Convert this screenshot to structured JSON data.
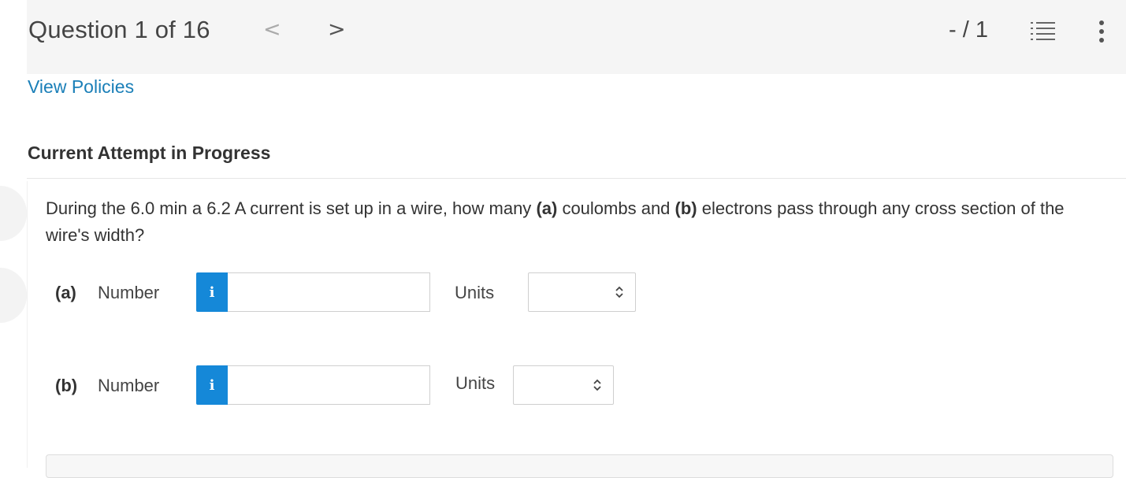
{
  "header": {
    "question_title": "Question 1 of 16",
    "prev_label": "<",
    "next_label": ">",
    "score": "- / 1"
  },
  "links": {
    "view_policies": "View Policies"
  },
  "attempt": {
    "status": "Current Attempt in Progress"
  },
  "question": {
    "text_1": "During the 6.0 min a 6.2 A current is set up in a wire, how many ",
    "part_a_bold": "(a)",
    "text_2": " coulombs and ",
    "part_b_bold": "(b)",
    "text_3": " electrons pass through any cross section of the wire's width?"
  },
  "parts": [
    {
      "label": "(a)",
      "number_label": "Number",
      "info_label": "i",
      "value": "",
      "units_label": "Units",
      "units_selected": ""
    },
    {
      "label": "(b)",
      "number_label": "Number",
      "info_label": "i",
      "value": "",
      "units_label": "Units",
      "units_selected": ""
    }
  ],
  "colors": {
    "accent": "#1588d8",
    "link": "#1a7fb8",
    "header_bg": "#f5f5f5"
  },
  "icons": [
    "chevron-left-icon",
    "chevron-right-icon",
    "list-icon",
    "more-vertical-icon",
    "info-icon",
    "select-caret-icon"
  ]
}
